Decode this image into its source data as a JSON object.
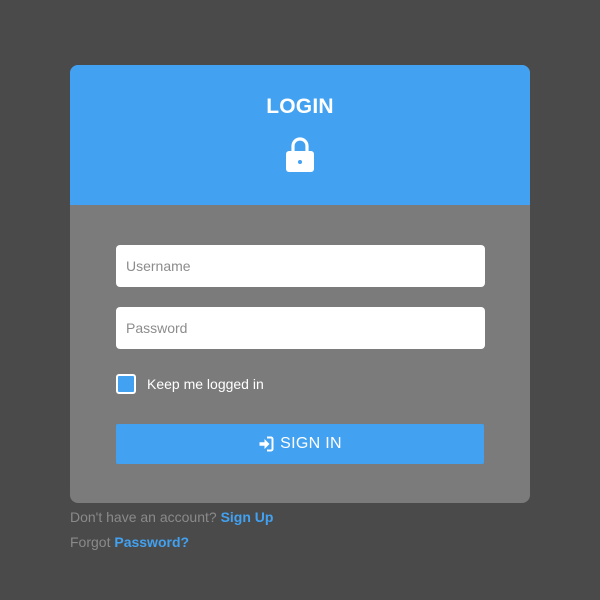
{
  "colors": {
    "background": "#4a4a4a",
    "card_body": "#7b7b7b",
    "accent": "#42a1f1",
    "white": "#ffffff",
    "muted_text": "#8a8a8a"
  },
  "header": {
    "title": "LOGIN",
    "icon": "lock-icon"
  },
  "form": {
    "username_placeholder": "Username",
    "username_value": "",
    "password_placeholder": "Password",
    "password_value": "",
    "remember_label": "Keep me logged in",
    "remember_checked": true,
    "signin_icon": "sign-in-icon",
    "signin_label": "SIGN IN"
  },
  "footer": {
    "signup_prompt": "Don't have an account?",
    "signup_link": "Sign Up",
    "forgot_prompt": "Forgot",
    "forgot_link": "Password?"
  }
}
